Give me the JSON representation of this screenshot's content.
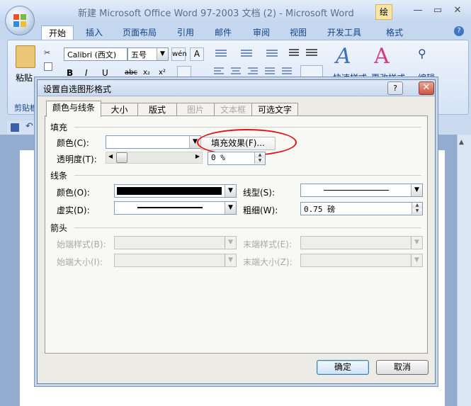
{
  "window": {
    "title": "新建 Microsoft Office Word 97-2003 文档 (2) - Microsoft Word",
    "contextual_tab": "绘",
    "ribbon_tabs": [
      "开始",
      "插入",
      "页面布局",
      "引用",
      "邮件",
      "审阅",
      "视图",
      "开发工具",
      "格式"
    ],
    "font_name": "Calibri (西文)",
    "font_size": "五号",
    "paste_label": "粘贴",
    "clipboard_group": "剪贴板",
    "quick_styles_label": "快速样式",
    "change_styles_label": "更改样式",
    "edit_label": "编辑"
  },
  "dialog": {
    "title": "设置自选图形格式",
    "help_button": "?",
    "close_button": "✕",
    "tabs": [
      "颜色与线条",
      "大小",
      "版式",
      "图片",
      "文本框",
      "可选文字"
    ],
    "fill": {
      "section": "填充",
      "color_label": "颜色(C):",
      "fill_effects_button": "填充效果(F)...",
      "transparency_label": "透明度(T):",
      "transparency_value": "0 %",
      "transparency_fraction": 0
    },
    "line": {
      "section": "线条",
      "color_label": "颜色(O):",
      "style_label": "线型(S):",
      "dash_label": "虚实(D):",
      "weight_label": "粗细(W):",
      "weight_value": "0.75 磅"
    },
    "arrows": {
      "section": "箭头",
      "begin_style_label": "始端样式(B):",
      "end_style_label": "末端样式(E):",
      "begin_size_label": "始端大小(I):",
      "end_size_label": "末端大小(Z):"
    },
    "ok_button": "确定",
    "cancel_button": "取消"
  },
  "colors": {
    "highlight": "#e41111",
    "title_text": "#5a6f8e"
  }
}
